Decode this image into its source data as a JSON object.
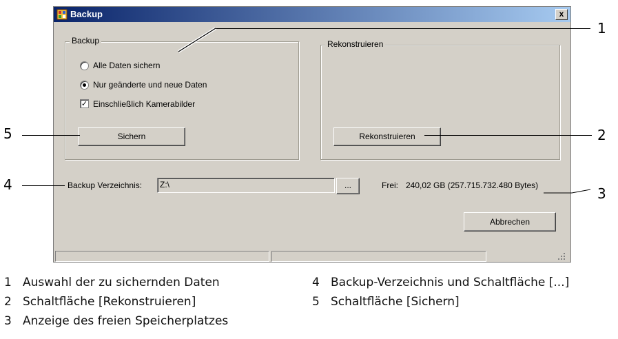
{
  "window": {
    "title": "Backup",
    "close_label": "x"
  },
  "backup_group": {
    "title": "Backup",
    "options": [
      {
        "label": "Alle Daten sichern",
        "selected": false
      },
      {
        "label": "Nur geänderte und neue Daten",
        "selected": true
      }
    ],
    "include_camera": {
      "label": "Einschließlich Kamerabilder",
      "checked": true
    },
    "save_button": "Sichern"
  },
  "restore_group": {
    "title": "Rekonstruieren",
    "restore_button": "Rekonstruieren"
  },
  "directory": {
    "label": "Backup Verzeichnis:",
    "value": "Z:\\",
    "browse_button": "...",
    "free_label": "Frei:",
    "free_value": "240,02 GB (257.715.732.480 Bytes)"
  },
  "cancel_button": "Abbrechen",
  "callouts": [
    "1",
    "2",
    "3",
    "4",
    "5"
  ],
  "legend": [
    {
      "num": "1",
      "text": "Auswahl der zu sichernden Daten"
    },
    {
      "num": "2",
      "text": "Schaltfläche [Rekonstruieren]"
    },
    {
      "num": "3",
      "text": "Anzeige des freien Speicherplatzes"
    },
    {
      "num": "4",
      "text": "Backup-Verzeichnis und Schaltfläche [...]"
    },
    {
      "num": "5",
      "text": "Schaltfläche [Sichern]"
    }
  ]
}
